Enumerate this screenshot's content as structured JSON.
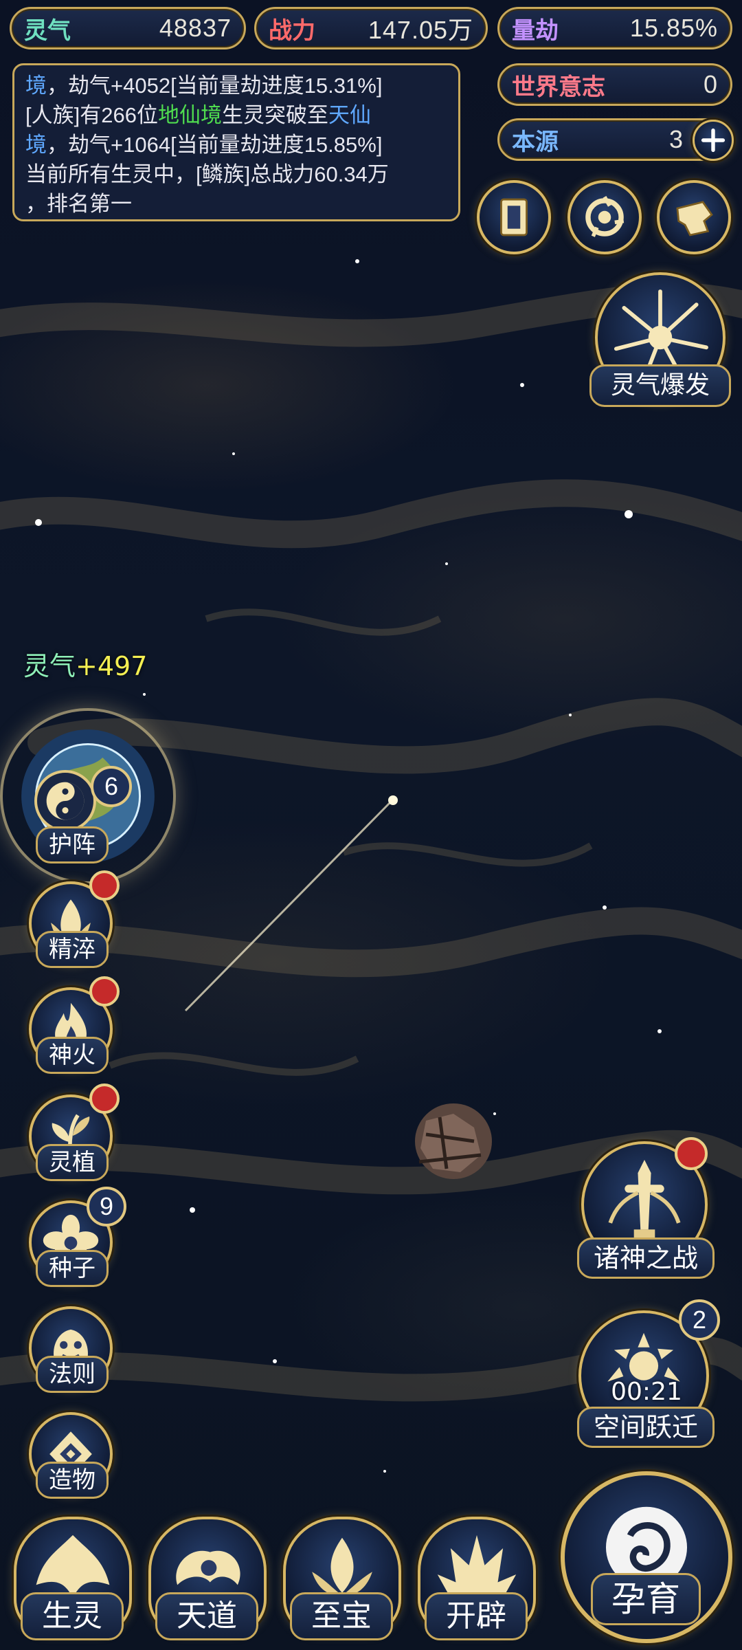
{
  "stats": {
    "lingqi": {
      "label": "灵气",
      "value": "48837"
    },
    "zhanli": {
      "label": "战力",
      "value": "147.05万"
    },
    "liangjie": {
      "label": "量劫",
      "value": "15.85%"
    },
    "shijie": {
      "label": "世界意志",
      "value": "0"
    },
    "benyuan": {
      "label": "本源",
      "value": "3"
    }
  },
  "log": {
    "line1_a": "境",
    "line1_b": "，劫气+4052[当前量劫进度15.31%]",
    "line2_a": "[人族]有266位",
    "line2_green": "地仙境",
    "line2_b": "生灵突破至",
    "line2_blue": "天仙",
    "line3_blue": "境",
    "line3_b": "，劫气+1064[当前量劫进度15.85%]",
    "line4": "当前所有生灵中，[鳞族]总战力60.34万",
    "line5": "，排名第一"
  },
  "gain_popup": {
    "label": "灵气",
    "value": "+497"
  },
  "right_buttons": {
    "burst": "灵气爆发",
    "war": "诸神之战",
    "leap": "空间跃迁",
    "leap_timer": "00:21",
    "leap_count": "2",
    "breed": "孕育"
  },
  "left_buttons": [
    {
      "label": "护阵",
      "badge": "6"
    },
    {
      "label": "精淬"
    },
    {
      "label": "神火"
    },
    {
      "label": "灵植"
    },
    {
      "label": "种子",
      "badge": "9"
    },
    {
      "label": "法则"
    },
    {
      "label": "造物"
    }
  ],
  "bottom_nav": [
    "生灵",
    "天道",
    "至宝",
    "开辟"
  ],
  "colors": {
    "gold": "#c8a85a",
    "panel": "#16203a",
    "red_dot": "#c52a2a"
  }
}
